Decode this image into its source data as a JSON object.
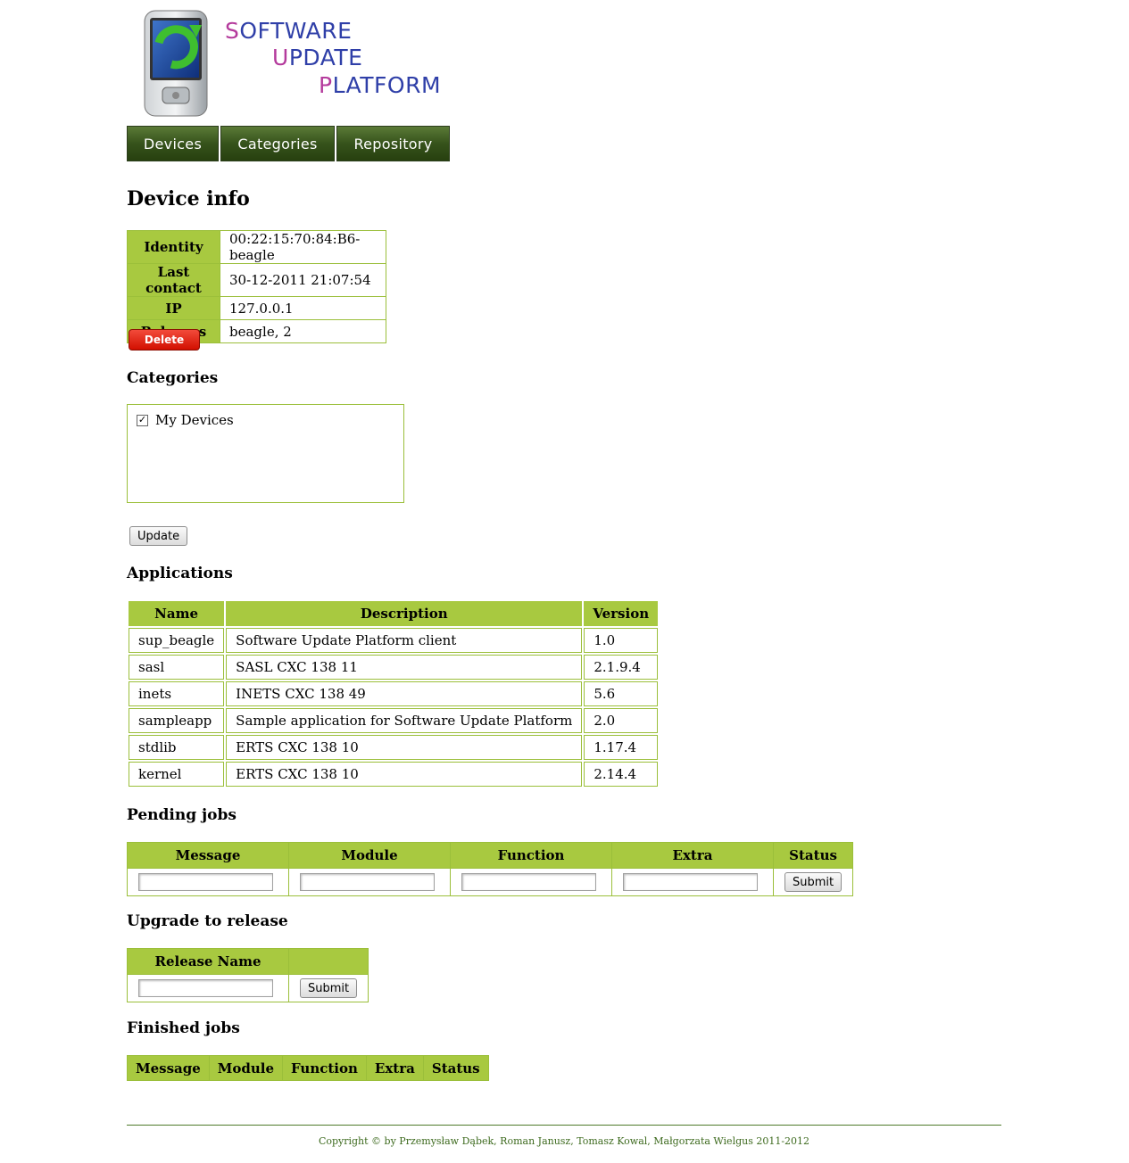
{
  "logo": {
    "line1_cap": "S",
    "line1_rest": "OFTWARE",
    "line2_cap": "U",
    "line2_rest": "PDATE",
    "line3_cap": "P",
    "line3_rest": "LATFORM"
  },
  "nav": {
    "items": [
      {
        "label": "Devices"
      },
      {
        "label": "Categories"
      },
      {
        "label": "Repository"
      }
    ]
  },
  "page_title": "Device info",
  "device_info": {
    "rows": [
      {
        "key": "Identity",
        "value": "00:22:15:70:84:B6-beagle"
      },
      {
        "key": "Last contact",
        "value": "30-12-2011 21:07:54"
      },
      {
        "key": "IP",
        "value": "127.0.0.1"
      },
      {
        "key": "Releases",
        "value": "beagle, 2"
      }
    ],
    "delete_label": "Delete"
  },
  "categories": {
    "heading": "Categories",
    "items": [
      {
        "label": "My Devices",
        "checked": true
      }
    ],
    "update_label": "Update"
  },
  "applications": {
    "heading": "Applications",
    "columns": [
      "Name",
      "Description",
      "Version"
    ],
    "rows": [
      [
        "sup_beagle",
        "Software Update Platform client",
        "1.0"
      ],
      [
        "sasl",
        "SASL CXC 138 11",
        "2.1.9.4"
      ],
      [
        "inets",
        "INETS CXC 138 49",
        "5.6"
      ],
      [
        "sampleapp",
        "Sample application for Software Update Platform",
        "2.0"
      ],
      [
        "stdlib",
        "ERTS CXC 138 10",
        "1.17.4"
      ],
      [
        "kernel",
        "ERTS CXC 138 10",
        "2.14.4"
      ]
    ]
  },
  "pending_jobs": {
    "heading": "Pending jobs",
    "columns": [
      "Message",
      "Module",
      "Function",
      "Extra",
      "Status"
    ],
    "inputs": {
      "message": "",
      "module": "",
      "function": "",
      "extra": ""
    },
    "submit_label": "Submit"
  },
  "upgrade": {
    "heading": "Upgrade to release",
    "column": "Release Name",
    "input_value": "",
    "submit_label": "Submit"
  },
  "finished_jobs": {
    "heading": "Finished jobs",
    "columns": [
      "Message",
      "Module",
      "Function",
      "Extra",
      "Status"
    ]
  },
  "footer": {
    "text": "Copyright © by Przemysław Dąbek, Roman Janusz, Tomasz Kowal, Małgorzata Wielgus 2011-2012"
  },
  "colors": {
    "header_green": "#a8c940",
    "nav_green": "#36531b",
    "logo_blue": "#2f3fa8",
    "logo_magenta": "#b43a9c",
    "delete_red": "#d20f00"
  }
}
